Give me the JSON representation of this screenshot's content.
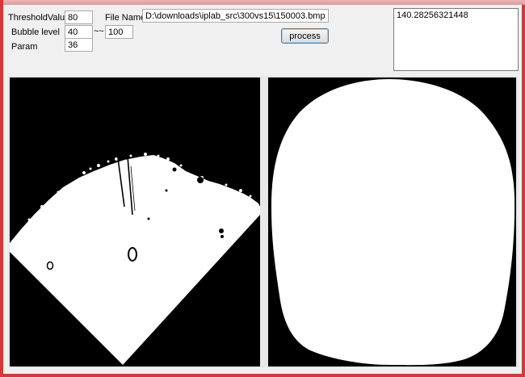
{
  "form": {
    "threshold_label": "ThresholdValue",
    "threshold_value": "80",
    "bubble_label": "Bubble level",
    "bubble_min": "40",
    "bubble_sep": "~~",
    "bubble_max": "100",
    "param_label": "Param",
    "param_value": "36",
    "filename_label": "File Name",
    "filename_value": "D:\\downloads\\iplab_src\\300vs15\\150003.bmp",
    "process_label": "process"
  },
  "result": {
    "text": "140.28256321448"
  },
  "images": {
    "left_icon": "binary-bubble-image",
    "right_icon": "binary-ellipse-image"
  },
  "colors": {
    "border": "#cf3b3b",
    "background": "#f0f0f0"
  }
}
